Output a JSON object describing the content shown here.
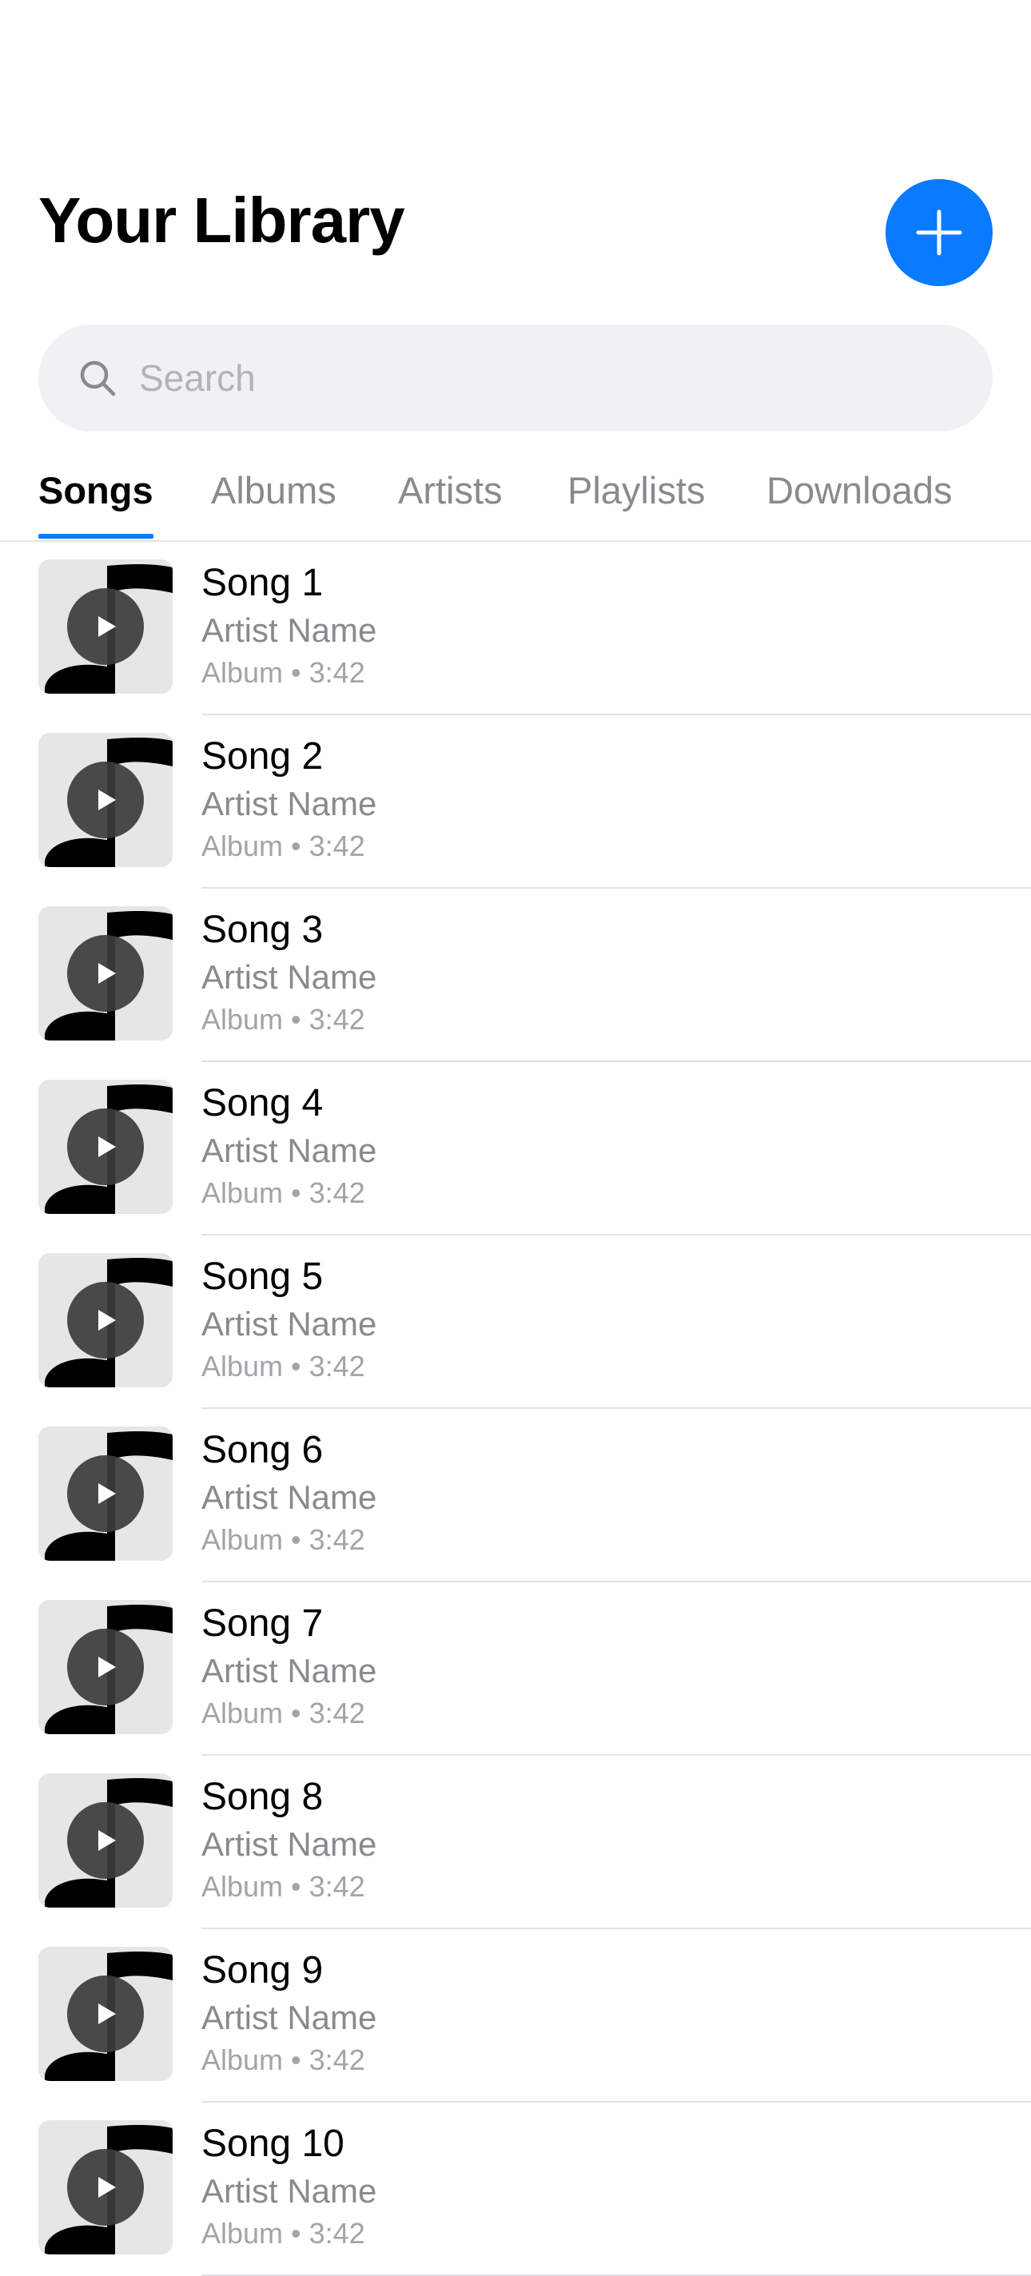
{
  "header": {
    "title": "Your Library",
    "add_icon": "plus-icon"
  },
  "search": {
    "placeholder": "Search",
    "value": "",
    "icon": "search-icon"
  },
  "tabs": [
    {
      "label": "Songs",
      "active": true
    },
    {
      "label": "Albums",
      "active": false
    },
    {
      "label": "Artists",
      "active": false
    },
    {
      "label": "Playlists",
      "active": false
    },
    {
      "label": "Downloads",
      "active": false
    }
  ],
  "songs": [
    {
      "title": "Song 1",
      "artist": "Artist Name",
      "album": "Album",
      "duration": "3:42",
      "meta": "Album • 3:42"
    },
    {
      "title": "Song 2",
      "artist": "Artist Name",
      "album": "Album",
      "duration": "3:42",
      "meta": "Album • 3:42"
    },
    {
      "title": "Song 3",
      "artist": "Artist Name",
      "album": "Album",
      "duration": "3:42",
      "meta": "Album • 3:42"
    },
    {
      "title": "Song 4",
      "artist": "Artist Name",
      "album": "Album",
      "duration": "3:42",
      "meta": "Album • 3:42"
    },
    {
      "title": "Song 5",
      "artist": "Artist Name",
      "album": "Album",
      "duration": "3:42",
      "meta": "Album • 3:42"
    },
    {
      "title": "Song 6",
      "artist": "Artist Name",
      "album": "Album",
      "duration": "3:42",
      "meta": "Album • 3:42"
    },
    {
      "title": "Song 7",
      "artist": "Artist Name",
      "album": "Album",
      "duration": "3:42",
      "meta": "Album • 3:42"
    },
    {
      "title": "Song 8",
      "artist": "Artist Name",
      "album": "Album",
      "duration": "3:42",
      "meta": "Album • 3:42"
    },
    {
      "title": "Song 9",
      "artist": "Artist Name",
      "album": "Album",
      "duration": "3:42",
      "meta": "Album • 3:42"
    },
    {
      "title": "Song 10",
      "artist": "Artist Name",
      "album": "Album",
      "duration": "3:42",
      "meta": "Album • 3:42"
    }
  ],
  "colors": {
    "accent": "#0a7aff",
    "secondary_text": "#8a8a8e",
    "tertiary_text": "#a3a3a8",
    "search_bg": "#f0f0f5"
  }
}
